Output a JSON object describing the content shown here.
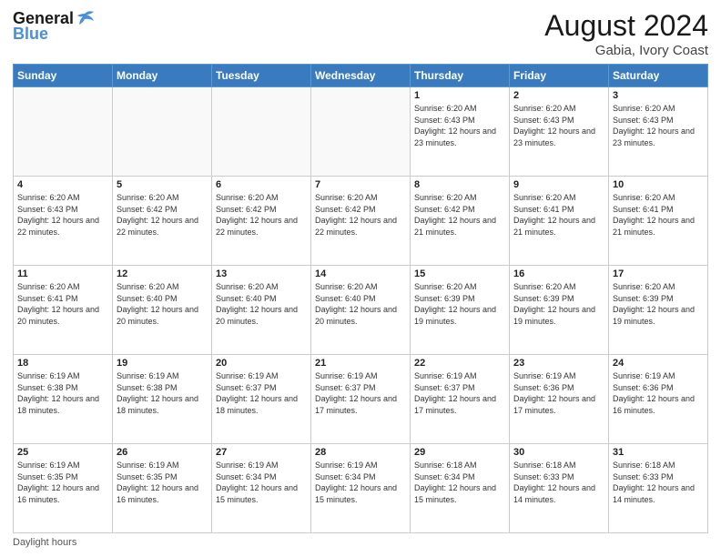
{
  "header": {
    "logo_general": "General",
    "logo_blue": "Blue",
    "month_year": "August 2024",
    "location": "Gabia, Ivory Coast"
  },
  "footer": {
    "daylight_hours": "Daylight hours"
  },
  "days_of_week": [
    "Sunday",
    "Monday",
    "Tuesday",
    "Wednesday",
    "Thursday",
    "Friday",
    "Saturday"
  ],
  "weeks": [
    [
      {
        "day": "",
        "sunrise": "",
        "sunset": "",
        "daylight": ""
      },
      {
        "day": "",
        "sunrise": "",
        "sunset": "",
        "daylight": ""
      },
      {
        "day": "",
        "sunrise": "",
        "sunset": "",
        "daylight": ""
      },
      {
        "day": "",
        "sunrise": "",
        "sunset": "",
        "daylight": ""
      },
      {
        "day": "1",
        "sunrise": "Sunrise: 6:20 AM",
        "sunset": "Sunset: 6:43 PM",
        "daylight": "Daylight: 12 hours and 23 minutes."
      },
      {
        "day": "2",
        "sunrise": "Sunrise: 6:20 AM",
        "sunset": "Sunset: 6:43 PM",
        "daylight": "Daylight: 12 hours and 23 minutes."
      },
      {
        "day": "3",
        "sunrise": "Sunrise: 6:20 AM",
        "sunset": "Sunset: 6:43 PM",
        "daylight": "Daylight: 12 hours and 23 minutes."
      }
    ],
    [
      {
        "day": "4",
        "sunrise": "Sunrise: 6:20 AM",
        "sunset": "Sunset: 6:43 PM",
        "daylight": "Daylight: 12 hours and 22 minutes."
      },
      {
        "day": "5",
        "sunrise": "Sunrise: 6:20 AM",
        "sunset": "Sunset: 6:42 PM",
        "daylight": "Daylight: 12 hours and 22 minutes."
      },
      {
        "day": "6",
        "sunrise": "Sunrise: 6:20 AM",
        "sunset": "Sunset: 6:42 PM",
        "daylight": "Daylight: 12 hours and 22 minutes."
      },
      {
        "day": "7",
        "sunrise": "Sunrise: 6:20 AM",
        "sunset": "Sunset: 6:42 PM",
        "daylight": "Daylight: 12 hours and 22 minutes."
      },
      {
        "day": "8",
        "sunrise": "Sunrise: 6:20 AM",
        "sunset": "Sunset: 6:42 PM",
        "daylight": "Daylight: 12 hours and 21 minutes."
      },
      {
        "day": "9",
        "sunrise": "Sunrise: 6:20 AM",
        "sunset": "Sunset: 6:41 PM",
        "daylight": "Daylight: 12 hours and 21 minutes."
      },
      {
        "day": "10",
        "sunrise": "Sunrise: 6:20 AM",
        "sunset": "Sunset: 6:41 PM",
        "daylight": "Daylight: 12 hours and 21 minutes."
      }
    ],
    [
      {
        "day": "11",
        "sunrise": "Sunrise: 6:20 AM",
        "sunset": "Sunset: 6:41 PM",
        "daylight": "Daylight: 12 hours and 20 minutes."
      },
      {
        "day": "12",
        "sunrise": "Sunrise: 6:20 AM",
        "sunset": "Sunset: 6:40 PM",
        "daylight": "Daylight: 12 hours and 20 minutes."
      },
      {
        "day": "13",
        "sunrise": "Sunrise: 6:20 AM",
        "sunset": "Sunset: 6:40 PM",
        "daylight": "Daylight: 12 hours and 20 minutes."
      },
      {
        "day": "14",
        "sunrise": "Sunrise: 6:20 AM",
        "sunset": "Sunset: 6:40 PM",
        "daylight": "Daylight: 12 hours and 20 minutes."
      },
      {
        "day": "15",
        "sunrise": "Sunrise: 6:20 AM",
        "sunset": "Sunset: 6:39 PM",
        "daylight": "Daylight: 12 hours and 19 minutes."
      },
      {
        "day": "16",
        "sunrise": "Sunrise: 6:20 AM",
        "sunset": "Sunset: 6:39 PM",
        "daylight": "Daylight: 12 hours and 19 minutes."
      },
      {
        "day": "17",
        "sunrise": "Sunrise: 6:20 AM",
        "sunset": "Sunset: 6:39 PM",
        "daylight": "Daylight: 12 hours and 19 minutes."
      }
    ],
    [
      {
        "day": "18",
        "sunrise": "Sunrise: 6:19 AM",
        "sunset": "Sunset: 6:38 PM",
        "daylight": "Daylight: 12 hours and 18 minutes."
      },
      {
        "day": "19",
        "sunrise": "Sunrise: 6:19 AM",
        "sunset": "Sunset: 6:38 PM",
        "daylight": "Daylight: 12 hours and 18 minutes."
      },
      {
        "day": "20",
        "sunrise": "Sunrise: 6:19 AM",
        "sunset": "Sunset: 6:37 PM",
        "daylight": "Daylight: 12 hours and 18 minutes."
      },
      {
        "day": "21",
        "sunrise": "Sunrise: 6:19 AM",
        "sunset": "Sunset: 6:37 PM",
        "daylight": "Daylight: 12 hours and 17 minutes."
      },
      {
        "day": "22",
        "sunrise": "Sunrise: 6:19 AM",
        "sunset": "Sunset: 6:37 PM",
        "daylight": "Daylight: 12 hours and 17 minutes."
      },
      {
        "day": "23",
        "sunrise": "Sunrise: 6:19 AM",
        "sunset": "Sunset: 6:36 PM",
        "daylight": "Daylight: 12 hours and 17 minutes."
      },
      {
        "day": "24",
        "sunrise": "Sunrise: 6:19 AM",
        "sunset": "Sunset: 6:36 PM",
        "daylight": "Daylight: 12 hours and 16 minutes."
      }
    ],
    [
      {
        "day": "25",
        "sunrise": "Sunrise: 6:19 AM",
        "sunset": "Sunset: 6:35 PM",
        "daylight": "Daylight: 12 hours and 16 minutes."
      },
      {
        "day": "26",
        "sunrise": "Sunrise: 6:19 AM",
        "sunset": "Sunset: 6:35 PM",
        "daylight": "Daylight: 12 hours and 16 minutes."
      },
      {
        "day": "27",
        "sunrise": "Sunrise: 6:19 AM",
        "sunset": "Sunset: 6:34 PM",
        "daylight": "Daylight: 12 hours and 15 minutes."
      },
      {
        "day": "28",
        "sunrise": "Sunrise: 6:19 AM",
        "sunset": "Sunset: 6:34 PM",
        "daylight": "Daylight: 12 hours and 15 minutes."
      },
      {
        "day": "29",
        "sunrise": "Sunrise: 6:18 AM",
        "sunset": "Sunset: 6:34 PM",
        "daylight": "Daylight: 12 hours and 15 minutes."
      },
      {
        "day": "30",
        "sunrise": "Sunrise: 6:18 AM",
        "sunset": "Sunset: 6:33 PM",
        "daylight": "Daylight: 12 hours and 14 minutes."
      },
      {
        "day": "31",
        "sunrise": "Sunrise: 6:18 AM",
        "sunset": "Sunset: 6:33 PM",
        "daylight": "Daylight: 12 hours and 14 minutes."
      }
    ]
  ]
}
